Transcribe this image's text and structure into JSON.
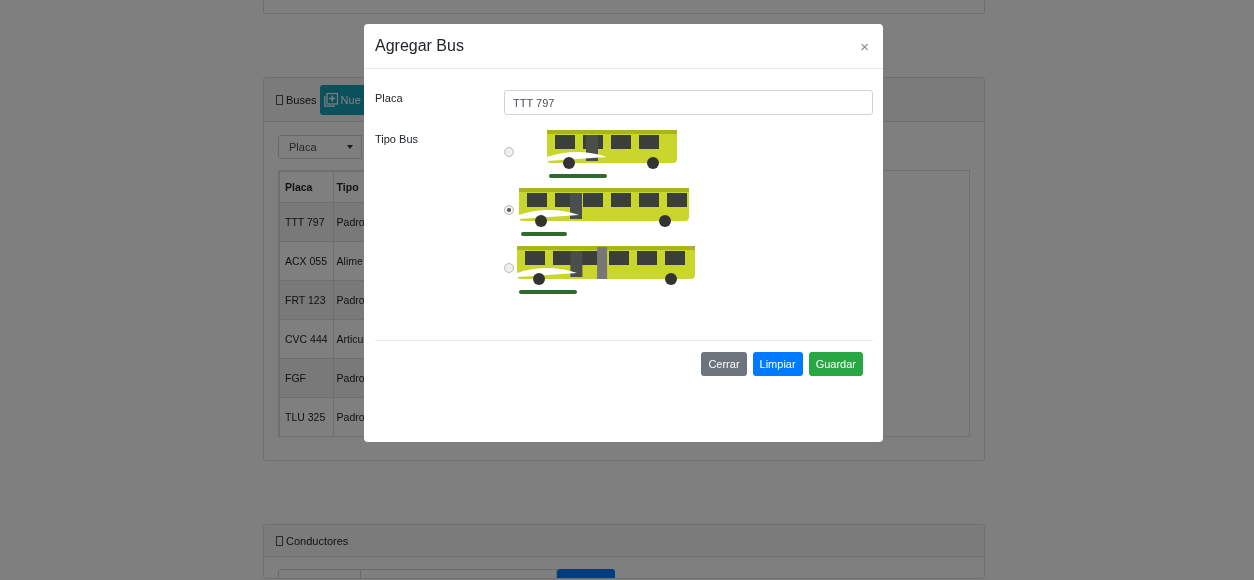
{
  "buses_card": {
    "title": "Buses",
    "new_button": "Nue",
    "filter": {
      "value": "Placa"
    },
    "table": {
      "columns": [
        "Placa",
        "Tipo"
      ],
      "rows": [
        [
          "TTT 797",
          "Padro"
        ],
        [
          "ACX 055",
          "Alime"
        ],
        [
          "FRT 123",
          "Padro"
        ],
        [
          "CVC 444",
          "Articu"
        ],
        [
          "FGF",
          "Padro"
        ],
        [
          "TLU 325",
          "Padro"
        ]
      ]
    }
  },
  "drivers_card": {
    "title": "Conductores"
  },
  "modal": {
    "title": "Agregar Bus",
    "close": "×",
    "fields": [
      {
        "kind": "text",
        "label": "Placa",
        "value": "TTT 797"
      },
      {
        "kind": "radio-images",
        "label": "Tipo Bus",
        "options": [
          {
            "kind": "picture",
            "selected": false
          },
          {
            "kind": "picture",
            "selected": true
          },
          {
            "kind": "picture",
            "selected": false
          }
        ]
      }
    ],
    "buttons": [
      {
        "label": "Cerrar",
        "kind": "secondary"
      },
      {
        "label": "Limpiar",
        "kind": "primary"
      },
      {
        "label": "Guardar",
        "kind": "success"
      }
    ]
  }
}
